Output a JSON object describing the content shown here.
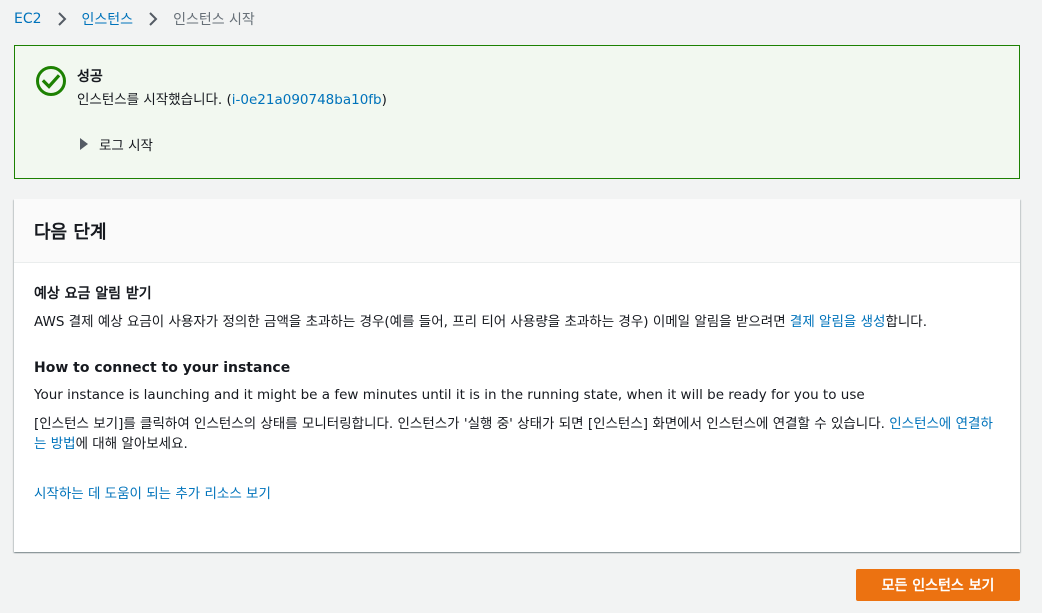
{
  "breadcrumb": {
    "items": [
      "EC2",
      "인스턴스"
    ],
    "current": "인스턴스 시작"
  },
  "flash": {
    "status": "success",
    "status_color": "#1d8102",
    "title": "성공",
    "message_prefix": "인스턴스를 시작했습니다. (",
    "instance_id": "i-0e21a090748ba10fb",
    "message_suffix": ")",
    "log_toggle_label": "로그 시작"
  },
  "next_steps": {
    "title": "다음 단계",
    "billing": {
      "heading": "예상 요금 알림 받기",
      "text_before": "AWS 결제 예상 요금이 사용자가 정의한 금액을 초과하는 경우(예를 들어, 프리 티어 사용량을 초과하는 경우) 이메일 알림을 받으려면 ",
      "link": "결제 알림을 생성",
      "text_after": "합니다."
    },
    "connect": {
      "heading": "How to connect to your instance",
      "line1": "Your instance is launching and it might be a few minutes until it is in the running state, when it will be ready for you to use",
      "line2_text": "[인스턴스 보기]를 클릭하여 인스턴스의 상태를 모니터링합니다. 인스턴스가 '실행 중' 상태가 되면 [인스턴스] 화면에서 인스턴스에 연결할 수 있습니다. ",
      "line2_link": "인스턴스에 연결하는 방법",
      "line2_after": "에 대해 알아보세요."
    },
    "more_resources_link": "시작하는 데 도움이 되는 추가 리소스 보기"
  },
  "actions": {
    "view_all_label": "모든 인스턴스 보기",
    "accent_color": "#ec7211"
  },
  "icons": {
    "success": "check-circle-icon",
    "breadcrumb_separator": "chevron-right-icon",
    "expand": "caret-right-icon"
  }
}
